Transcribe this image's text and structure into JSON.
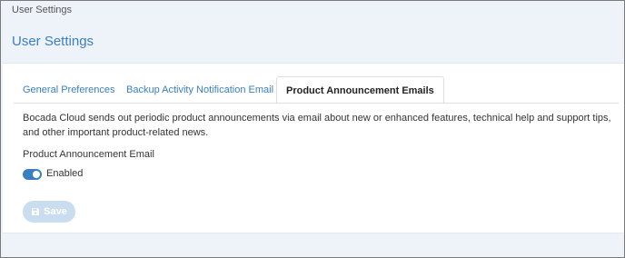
{
  "breadcrumb": "User Settings",
  "page_title": "User Settings",
  "tabs": [
    {
      "label": "General Preferences",
      "active": false
    },
    {
      "label": "Backup Activity Notification Email",
      "active": false
    },
    {
      "label": "Product Announcement Emails",
      "active": true
    }
  ],
  "content": {
    "description": "Bocada Cloud sends out periodic product announcements via email about new or enhanced features, technical help and support tips, and other important product-related news.",
    "field_label": "Product Announcement Email",
    "toggle_state": "on",
    "toggle_label": "Enabled",
    "save_label": "Save",
    "save_icon": "floppy-disk-icon"
  },
  "colors": {
    "accent": "#3a7fc1",
    "background": "#eef3fa",
    "save_disabled": "#c9dcf0"
  }
}
